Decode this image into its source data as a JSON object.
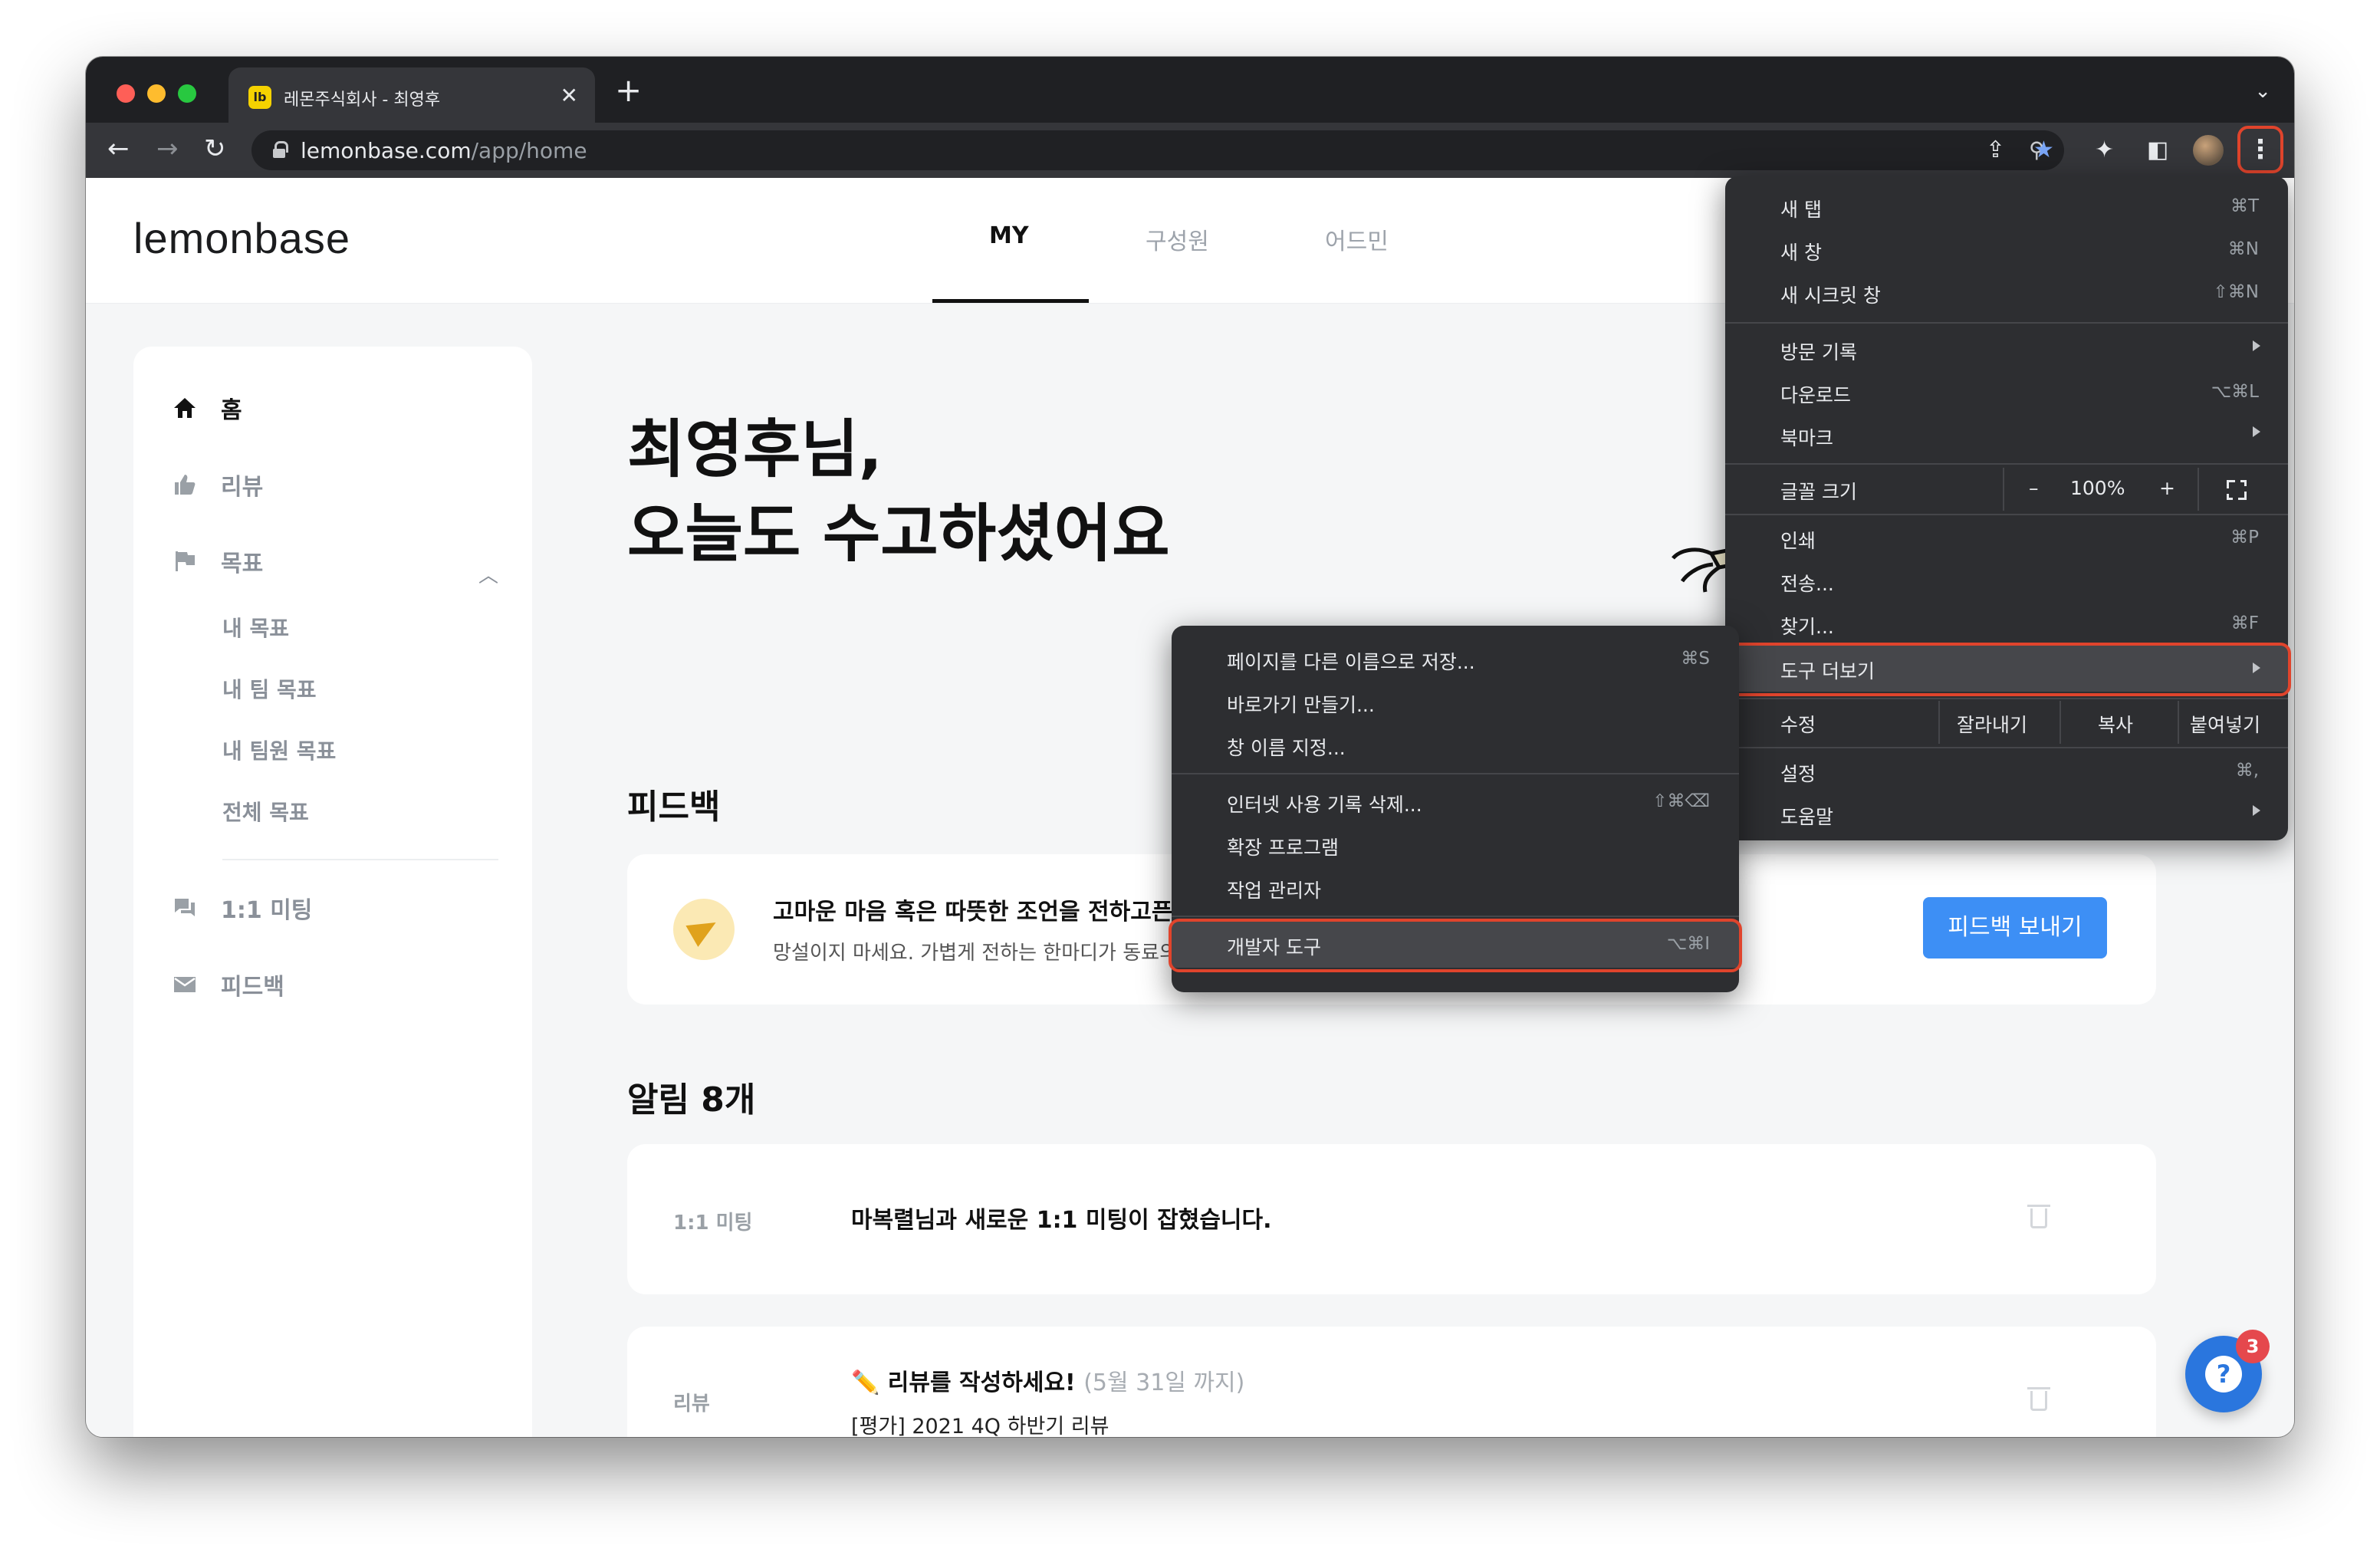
{
  "browser": {
    "tab_title": "레몬주식회사 - 최영후",
    "tab_favicon": "lb",
    "url_host": "lemonbase.com",
    "url_path": "/app/home"
  },
  "app": {
    "logo": "lemonbase",
    "nav_tabs": [
      {
        "label": "MY",
        "active": true
      },
      {
        "label": "구성원",
        "active": false
      },
      {
        "label": "어드민",
        "active": false
      }
    ]
  },
  "sidebar": {
    "items": [
      {
        "label": "홈",
        "icon": "home-icon",
        "active": true
      },
      {
        "label": "리뷰",
        "icon": "thumbs-up-icon"
      },
      {
        "label": "목표",
        "icon": "flag-icon"
      },
      {
        "label": "1:1 미팅",
        "icon": "chat-icon"
      },
      {
        "label": "피드백",
        "icon": "mail-icon"
      }
    ],
    "goal_subitems": [
      "내 목표",
      "내 팀 목표",
      "내 팀원 목표",
      "전체 목표"
    ]
  },
  "main": {
    "greeting_line1": "최영후님,",
    "greeting_line2": "오늘도 수고하셨어요",
    "feedback": {
      "section_title": "피드백",
      "card_title": "고마운 마음 혹은 따뜻한 조언을 전하고픈",
      "card_desc": "망설이지 마세요. 가볍게 전하는 한마디가 동료의",
      "button": "피드백 보내기"
    },
    "notifications": {
      "section_title": "알림 8개",
      "items": [
        {
          "category": "1:1 미팅",
          "text": "마복렬님과 새로운 1:1 미팅이 잡혔습니다."
        },
        {
          "category": "리뷰",
          "text": "✏️ 리뷰를 작성하세요!",
          "hint": "(5월 31일 까지)",
          "sub": "[평가] 2021 4Q 하반기 리뷰"
        }
      ]
    }
  },
  "help_badge": "3",
  "chrome_menu": {
    "new_tab": {
      "label": "새 탭",
      "shortcut": "⌘T"
    },
    "new_window": {
      "label": "새 창",
      "shortcut": "⌘N"
    },
    "incognito": {
      "label": "새 시크릿 창",
      "shortcut": "⇧⌘N"
    },
    "history": {
      "label": "방문 기록"
    },
    "downloads": {
      "label": "다운로드",
      "shortcut": "⌥⌘L"
    },
    "bookmarks": {
      "label": "북마크"
    },
    "zoom": {
      "label": "글꼴 크기",
      "minus": "–",
      "value": "100%",
      "plus": "+"
    },
    "print": {
      "label": "인쇄",
      "shortcut": "⌘P"
    },
    "cast": {
      "label": "전송..."
    },
    "find": {
      "label": "찾기...",
      "shortcut": "⌘F"
    },
    "more_tools": {
      "label": "도구 더보기"
    },
    "edit": {
      "label": "수정",
      "cut": "잘라내기",
      "copy": "복사",
      "paste": "붙여넣기"
    },
    "settings": {
      "label": "설정",
      "shortcut": "⌘,"
    },
    "help": {
      "label": "도움말"
    }
  },
  "more_tools_menu": {
    "save_page": {
      "label": "페이지를 다른 이름으로 저장...",
      "shortcut": "⌘S"
    },
    "create_shortcut": {
      "label": "바로가기 만들기..."
    },
    "name_window": {
      "label": "창 이름 지정..."
    },
    "clear_data": {
      "label": "인터넷 사용 기록 삭제...",
      "shortcut": "⇧⌘⌫"
    },
    "extensions": {
      "label": "확장 프로그램"
    },
    "task_manager": {
      "label": "작업 관리자"
    },
    "dev_tools": {
      "label": "개발자 도구",
      "shortcut": "⌥⌘I"
    }
  },
  "colors": {
    "accent": "#3d8ff5",
    "highlight": "#e0442c",
    "chrome_dark": "#35363a"
  }
}
